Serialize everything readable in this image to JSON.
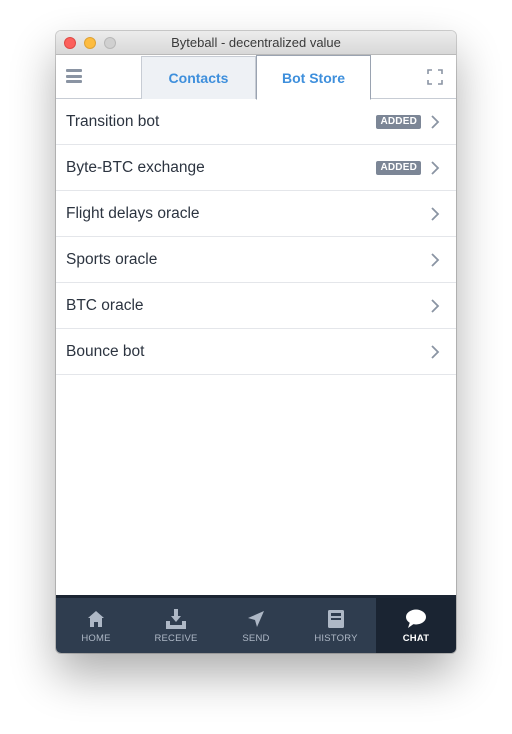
{
  "window": {
    "title": "Byteball - decentralized value"
  },
  "header": {
    "tabs": [
      {
        "label": "Contacts",
        "active": false
      },
      {
        "label": "Bot Store",
        "active": true
      }
    ]
  },
  "bots": [
    {
      "name": "Transition bot",
      "badge": "ADDED"
    },
    {
      "name": "Byte-BTC exchange",
      "badge": "ADDED"
    },
    {
      "name": "Flight delays oracle",
      "badge": ""
    },
    {
      "name": "Sports oracle",
      "badge": ""
    },
    {
      "name": "BTC oracle",
      "badge": ""
    },
    {
      "name": "Bounce bot",
      "badge": ""
    }
  ],
  "nav": {
    "items": [
      {
        "label": "HOME",
        "icon": "home-icon",
        "active": false
      },
      {
        "label": "RECEIVE",
        "icon": "receive-icon",
        "active": false
      },
      {
        "label": "SEND",
        "icon": "send-icon",
        "active": false
      },
      {
        "label": "HISTORY",
        "icon": "history-icon",
        "active": false
      },
      {
        "label": "CHAT",
        "icon": "chat-icon",
        "active": true
      }
    ]
  },
  "colors": {
    "accent": "#3e8fdc",
    "navbar": "#2f3d4f",
    "navbar_active": "#1a2432",
    "badge": "#7c8696"
  }
}
